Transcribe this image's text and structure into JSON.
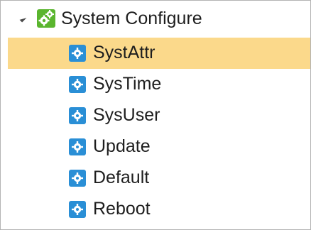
{
  "tree": {
    "root": {
      "label": "System Configure",
      "icon": "gears-icon",
      "expanded": true
    },
    "children": [
      {
        "label": "SystAttr",
        "icon": "gear-icon",
        "selected": true
      },
      {
        "label": "SysTime",
        "icon": "gear-icon",
        "selected": false
      },
      {
        "label": "SysUser",
        "icon": "gear-icon",
        "selected": false
      },
      {
        "label": "Update",
        "icon": "gear-icon",
        "selected": false
      },
      {
        "label": "Default",
        "icon": "gear-icon",
        "selected": false
      },
      {
        "label": "Reboot",
        "icon": "gear-icon",
        "selected": false
      }
    ]
  },
  "colors": {
    "selection": "#fbd98b",
    "leaf_icon_bg": "#2a8fd6",
    "root_icon_green": "#5ab52e",
    "text": "#1e1e1e"
  }
}
